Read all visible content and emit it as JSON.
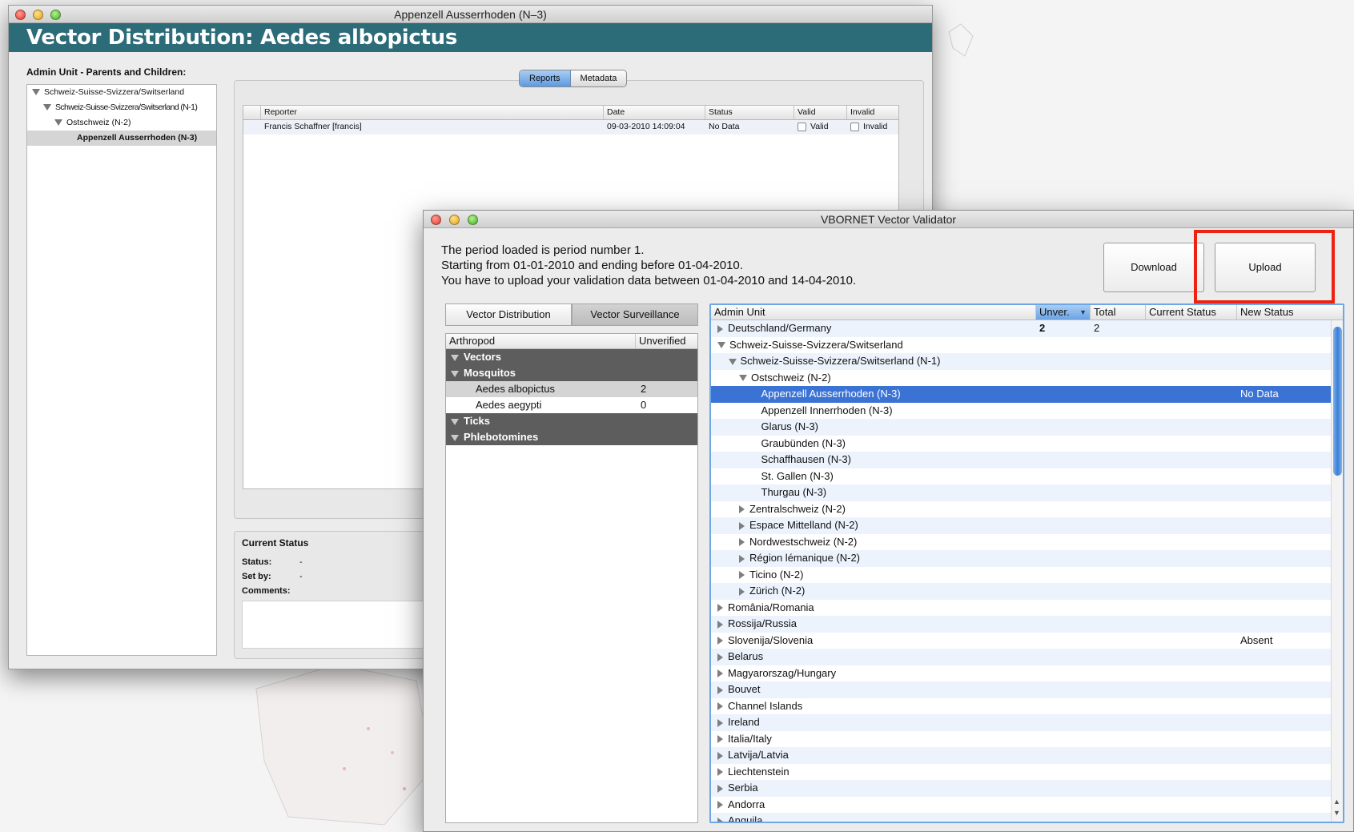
{
  "window1": {
    "title": "Appenzell Ausserrhoden (N–3)",
    "banner": "Vector Distribution: Aedes albopictus",
    "admin_heading": "Admin Unit - Parents and Children:",
    "tree": [
      {
        "label": "Schweiz-Suisse-Svizzera/Switserland",
        "indent": 0,
        "expanded": true
      },
      {
        "label": "Schweiz-Suisse-Svizzera/Switserland (N-1)",
        "indent": 1,
        "expanded": true
      },
      {
        "label": "Ostschweiz (N-2)",
        "indent": 2,
        "expanded": true
      },
      {
        "label": "Appenzell Ausserrhoden (N-3)",
        "indent": 3,
        "selected": true
      }
    ],
    "tabs": {
      "reports": "Reports",
      "metadata": "Metadata"
    },
    "report_columns": [
      "Reporter",
      "Date",
      "Status",
      "Valid",
      "Invalid"
    ],
    "report_rows": [
      {
        "reporter": "Francis Schaffner [francis]",
        "date": "09-03-2010 14:09:04",
        "status": "No Data",
        "valid_label": "Valid",
        "invalid_label": "Invalid"
      }
    ],
    "current_status": {
      "title": "Current Status",
      "status_label": "Status:",
      "status_value": "-",
      "setby_label": "Set by:",
      "setby_value": "-",
      "comments_label": "Comments:"
    }
  },
  "window2": {
    "title": "VBORNET Vector Validator",
    "period_lines": [
      "The period loaded is period number 1.",
      "Starting from 01-01-2010 and ending before 01-04-2010.",
      "You have to upload your validation data between 01-04-2010 and 14-04-2010."
    ],
    "download_label": "Download",
    "upload_label": "Upload",
    "tabs": {
      "distribution": "Vector Distribution",
      "surveillance": "Vector Surveillance"
    },
    "arthropod_columns": [
      "Arthropod",
      "Unverified"
    ],
    "groups": {
      "vectors": "Vectors",
      "mosquitos": "Mosquitos",
      "ticks": "Ticks",
      "phlebotomines": "Phlebotomines"
    },
    "mosquito_items": [
      {
        "name": "Aedes albopictus",
        "unverified": "2"
      },
      {
        "name": "Aedes aegypti",
        "unverified": "0"
      }
    ],
    "admin_columns": [
      "Admin Unit",
      "Unver.",
      "Total",
      "Current Status",
      "New Status"
    ],
    "admin_rows": [
      {
        "name": "Deutschland/Germany",
        "indent": 0,
        "state": "collapsed",
        "unver": "2",
        "total": "2",
        "current": "",
        "new": ""
      },
      {
        "name": "Schweiz-Suisse-Svizzera/Switserland",
        "indent": 0,
        "state": "expanded",
        "unver": "",
        "total": "",
        "current": "",
        "new": ""
      },
      {
        "name": "Schweiz-Suisse-Svizzera/Switserland (N-1)",
        "indent": 1,
        "state": "expanded",
        "unver": "",
        "total": "",
        "current": "",
        "new": ""
      },
      {
        "name": "Ostschweiz (N-2)",
        "indent": 2,
        "state": "expanded",
        "unver": "",
        "total": "",
        "current": "",
        "new": ""
      },
      {
        "name": "Appenzell Ausserrhoden (N-3)",
        "indent": 3,
        "state": "leaf",
        "unver": "",
        "total": "",
        "current": "",
        "new": "No Data",
        "selected": true
      },
      {
        "name": "Appenzell Innerrhoden (N-3)",
        "indent": 3,
        "state": "leaf",
        "unver": "",
        "total": "",
        "current": "",
        "new": ""
      },
      {
        "name": "Glarus (N-3)",
        "indent": 3,
        "state": "leaf",
        "unver": "",
        "total": "",
        "current": "",
        "new": ""
      },
      {
        "name": "Graubünden (N-3)",
        "indent": 3,
        "state": "leaf",
        "unver": "",
        "total": "",
        "current": "",
        "new": ""
      },
      {
        "name": "Schaffhausen (N-3)",
        "indent": 3,
        "state": "leaf",
        "unver": "",
        "total": "",
        "current": "",
        "new": ""
      },
      {
        "name": "St. Gallen (N-3)",
        "indent": 3,
        "state": "leaf",
        "unver": "",
        "total": "",
        "current": "",
        "new": ""
      },
      {
        "name": "Thurgau (N-3)",
        "indent": 3,
        "state": "leaf",
        "unver": "",
        "total": "",
        "current": "",
        "new": ""
      },
      {
        "name": "Zentralschweiz (N-2)",
        "indent": 2,
        "state": "collapsed",
        "unver": "",
        "total": "",
        "current": "",
        "new": ""
      },
      {
        "name": "Espace Mittelland (N-2)",
        "indent": 2,
        "state": "collapsed",
        "unver": "",
        "total": "",
        "current": "",
        "new": ""
      },
      {
        "name": "Nordwestschweiz (N-2)",
        "indent": 2,
        "state": "collapsed",
        "unver": "",
        "total": "",
        "current": "",
        "new": ""
      },
      {
        "name": "Région lémanique (N-2)",
        "indent": 2,
        "state": "collapsed",
        "unver": "",
        "total": "",
        "current": "",
        "new": ""
      },
      {
        "name": "Ticino (N-2)",
        "indent": 2,
        "state": "collapsed",
        "unver": "",
        "total": "",
        "current": "",
        "new": ""
      },
      {
        "name": "Zürich (N-2)",
        "indent": 2,
        "state": "collapsed",
        "unver": "",
        "total": "",
        "current": "",
        "new": ""
      },
      {
        "name": "România/Romania",
        "indent": 0,
        "state": "collapsed",
        "unver": "",
        "total": "",
        "current": "",
        "new": ""
      },
      {
        "name": "Rossija/Russia",
        "indent": 0,
        "state": "collapsed",
        "unver": "",
        "total": "",
        "current": "",
        "new": ""
      },
      {
        "name": "Slovenija/Slovenia",
        "indent": 0,
        "state": "collapsed",
        "unver": "",
        "total": "",
        "current": "",
        "new": "Absent"
      },
      {
        "name": "Belarus",
        "indent": 0,
        "state": "collapsed",
        "unver": "",
        "total": "",
        "current": "",
        "new": ""
      },
      {
        "name": "Magyarorszag/Hungary",
        "indent": 0,
        "state": "collapsed",
        "unver": "",
        "total": "",
        "current": "",
        "new": ""
      },
      {
        "name": "Bouvet",
        "indent": 0,
        "state": "collapsed",
        "unver": "",
        "total": "",
        "current": "",
        "new": ""
      },
      {
        "name": "Channel Islands",
        "indent": 0,
        "state": "collapsed",
        "unver": "",
        "total": "",
        "current": "",
        "new": ""
      },
      {
        "name": "Ireland",
        "indent": 0,
        "state": "collapsed",
        "unver": "",
        "total": "",
        "current": "",
        "new": ""
      },
      {
        "name": "Italia/Italy",
        "indent": 0,
        "state": "collapsed",
        "unver": "",
        "total": "",
        "current": "",
        "new": ""
      },
      {
        "name": "Latvija/Latvia",
        "indent": 0,
        "state": "collapsed",
        "unver": "",
        "total": "",
        "current": "",
        "new": ""
      },
      {
        "name": "Liechtenstein",
        "indent": 0,
        "state": "collapsed",
        "unver": "",
        "total": "",
        "current": "",
        "new": ""
      },
      {
        "name": "Serbia",
        "indent": 0,
        "state": "collapsed",
        "unver": "",
        "total": "",
        "current": "",
        "new": ""
      },
      {
        "name": "Andorra",
        "indent": 0,
        "state": "collapsed",
        "unver": "",
        "total": "",
        "current": "",
        "new": ""
      },
      {
        "name": "Anguila",
        "indent": 0,
        "state": "collapsed",
        "unver": "",
        "total": "",
        "current": "",
        "new": ""
      }
    ]
  },
  "colors": {
    "banner": "#2c6b78",
    "selection": "#3b73d5",
    "highlight": "#ee2211"
  }
}
